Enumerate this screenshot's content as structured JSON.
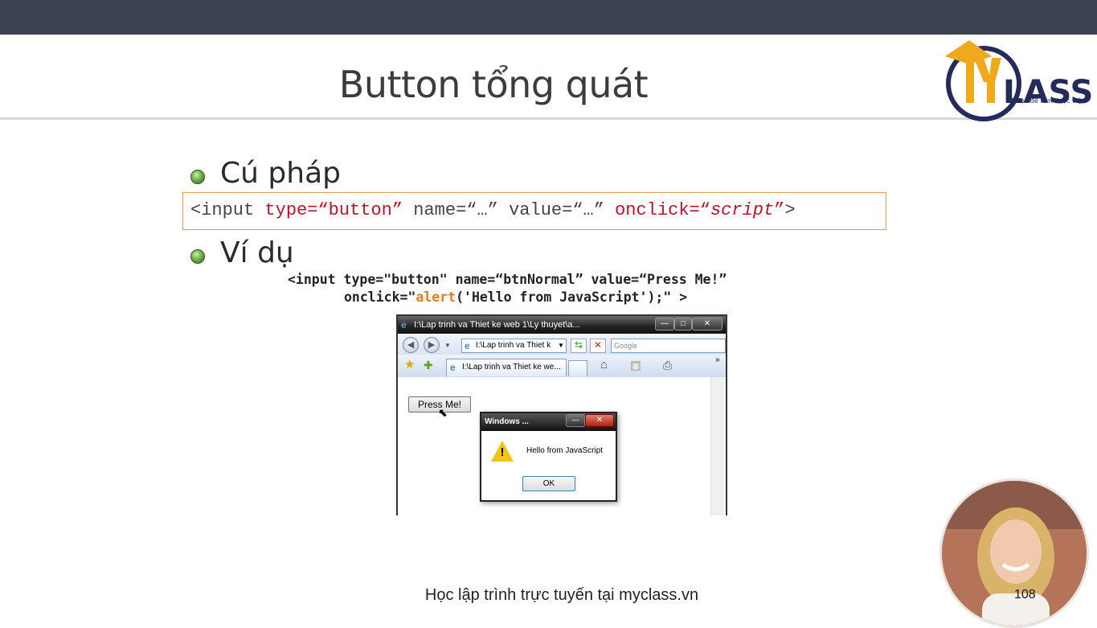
{
  "slide": {
    "title": "Button tổng quát",
    "page_number": "108",
    "footer": "Học lập trình trực tuyến tại myclass.vn"
  },
  "logo": {
    "text": "LASS",
    "tagline": "Học để làm được việc"
  },
  "sections": {
    "syntax_heading": "Cú pháp",
    "example_heading": "Ví dụ"
  },
  "syntax": {
    "p1": "<input ",
    "p2": "type=“button”",
    "p3": " name=“…” value=“…” ",
    "p4": "onclick=“",
    "p5": "script",
    "p6": "”",
    "p7": ">"
  },
  "example": {
    "line1": "<input type=\"button\" name=“btnNormal” value=“Press Me!”",
    "line2_a": "onclick=\"",
    "line2_b": "alert",
    "line2_c": "('Hello from JavaScript');\" >"
  },
  "browser": {
    "window_title": "I:\\Lap trinh va Thiet ke web 1\\Ly thuyet\\a...",
    "address": "I:\\Lap trinh va Thiet k",
    "search_placeholder": "Google",
    "tab_title": "I:\\Lap trinh va Thiet ke we...",
    "button_label": "Press Me!",
    "chevrons": "»"
  },
  "dialog": {
    "title": "Windows ...",
    "message": "Hello from JavaScript",
    "ok_label": "OK",
    "close_glyph": "✕"
  }
}
